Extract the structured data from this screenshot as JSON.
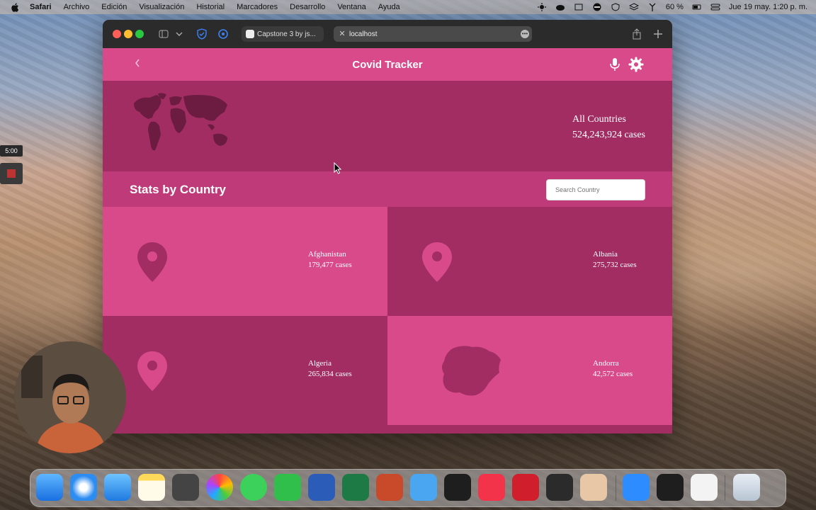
{
  "menubar": {
    "app": "Safari",
    "items": [
      "Archivo",
      "Edición",
      "Visualización",
      "Historial",
      "Marcadores",
      "Desarrollo",
      "Ventana",
      "Ayuda"
    ],
    "battery": "60 %",
    "datetime": "Jue 19 may.  1:20 p. m."
  },
  "browser": {
    "tabs": [
      {
        "label": "Capstone 3 by js..."
      },
      {
        "label": "localhost"
      }
    ]
  },
  "app": {
    "title": "Covid Tracker",
    "hero": {
      "label": "All Countries",
      "cases": "524,243,924 cases"
    },
    "section_title": "Stats by Country",
    "search_placeholder": "Search Country",
    "countries": [
      {
        "name": "Afghanistan",
        "cases": "179,477 cases"
      },
      {
        "name": "Albania",
        "cases": "275,732 cases"
      },
      {
        "name": "Algeria",
        "cases": "265,834 cases"
      },
      {
        "name": "Andorra",
        "cases": "42,572 cases"
      }
    ]
  },
  "recorder": {
    "timer": "5:00"
  },
  "colors": {
    "pink": "#d94a8b",
    "dark_pink": "#a12d63",
    "section_pink": "#bf3a78"
  }
}
